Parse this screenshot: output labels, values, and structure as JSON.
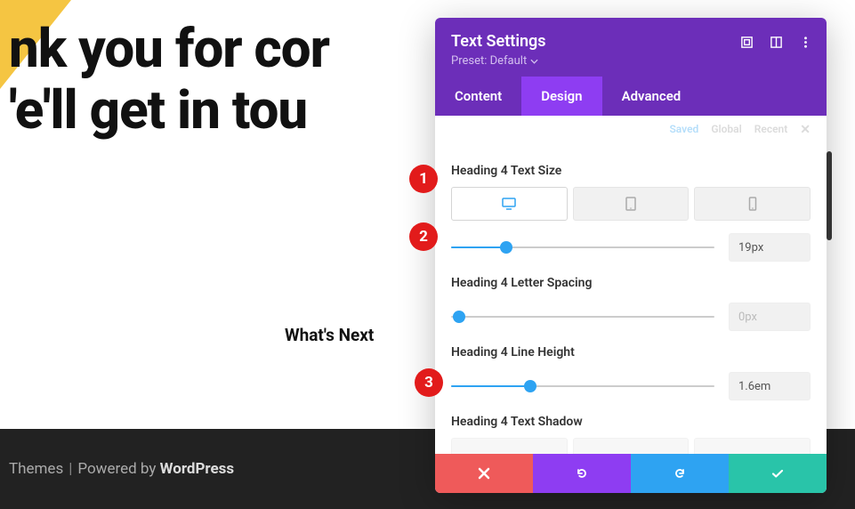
{
  "headline": {
    "line1": "nk you for cor",
    "line2": "'e'll get in tou"
  },
  "whats_next": "What's Next",
  "footer": {
    "themes": "Themes",
    "powered": "Powered by",
    "wp": "WordPress"
  },
  "panel": {
    "title": "Text Settings",
    "preset": "Preset: Default",
    "tabs": {
      "content": "Content",
      "design": "Design",
      "advanced": "Advanced"
    },
    "faint": {
      "saved": "Saved",
      "global": "Global",
      "recent": "Recent"
    },
    "options": {
      "textSize": {
        "label": "Heading 4 Text Size",
        "value": "19px"
      },
      "letterSpacing": {
        "label": "Heading 4 Letter Spacing",
        "value": "0px"
      },
      "lineHeight": {
        "label": "Heading 4 Line Height",
        "value": "1.6em"
      },
      "textShadow": {
        "label": "Heading 4 Text Shadow"
      }
    }
  },
  "markers": {
    "m1": "1",
    "m2": "2",
    "m3": "3"
  }
}
